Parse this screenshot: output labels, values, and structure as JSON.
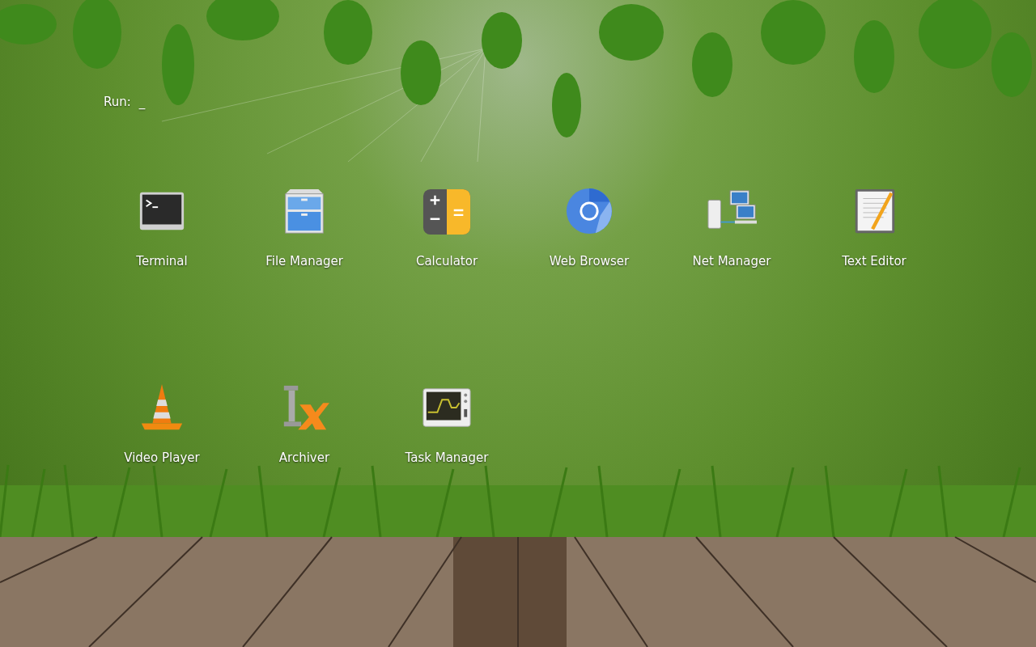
{
  "run_prompt": {
    "label": "Run:",
    "value": "_"
  },
  "launchers": [
    {
      "label": "Terminal",
      "kind": "terminal"
    },
    {
      "label": "File Manager",
      "kind": "files"
    },
    {
      "label": "Calculator",
      "kind": "calculator"
    },
    {
      "label": "Web Browser",
      "kind": "browser"
    },
    {
      "label": "Net Manager",
      "kind": "network"
    },
    {
      "label": "Text Editor",
      "kind": "editor"
    },
    {
      "label": "Video Player",
      "kind": "video"
    },
    {
      "label": "Archiver",
      "kind": "archiver"
    },
    {
      "label": "Task Manager",
      "kind": "monitor"
    }
  ]
}
